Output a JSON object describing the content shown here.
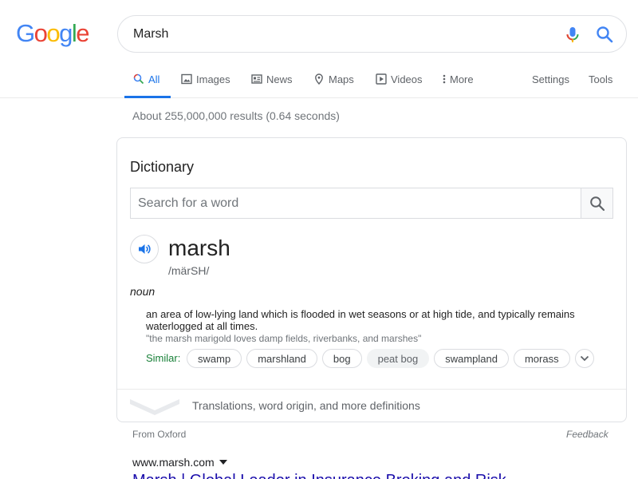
{
  "header": {
    "logo_letters": [
      "G",
      "o",
      "o",
      "g",
      "l",
      "e"
    ],
    "logo_colors": [
      "#4285F4",
      "#EA4335",
      "#FBBC05",
      "#4285F4",
      "#34A853",
      "#EA4335"
    ],
    "search_value": "Marsh"
  },
  "tabs": {
    "items": [
      {
        "label": "All",
        "icon": "search-icon"
      },
      {
        "label": "Images",
        "icon": "image-icon"
      },
      {
        "label": "News",
        "icon": "news-icon"
      },
      {
        "label": "Maps",
        "icon": "map-pin-icon"
      },
      {
        "label": "Videos",
        "icon": "play-icon"
      },
      {
        "label": "More",
        "icon": "more-vert-icon"
      }
    ],
    "settings": "Settings",
    "tools": "Tools"
  },
  "result_stats": "About 255,000,000 results (0.64 seconds)",
  "dictionary": {
    "title": "Dictionary",
    "search_placeholder": "Search for a word",
    "word": "marsh",
    "pronunciation": "/märSH/",
    "part_of_speech": "noun",
    "definition": "an area of low-lying land which is flooded in wet seasons or at high tide, and typically remains waterlogged at all times.",
    "example": "\"the marsh marigold loves damp fields, riverbanks, and marshes\"",
    "similar_label": "Similar:",
    "similar": [
      "swamp",
      "marshland",
      "bog",
      "peat bog",
      "swampland",
      "morass"
    ],
    "more_link": "Translations, word origin, and more definitions"
  },
  "source": "From Oxford",
  "feedback": "Feedback",
  "first_result": {
    "url": "www.marsh.com",
    "title": "Marsh | Global Leader in Insurance Broking and Risk"
  },
  "colors": {
    "accent": "#1a73e8",
    "link": "#1a0dab",
    "similar_green": "#188038"
  }
}
